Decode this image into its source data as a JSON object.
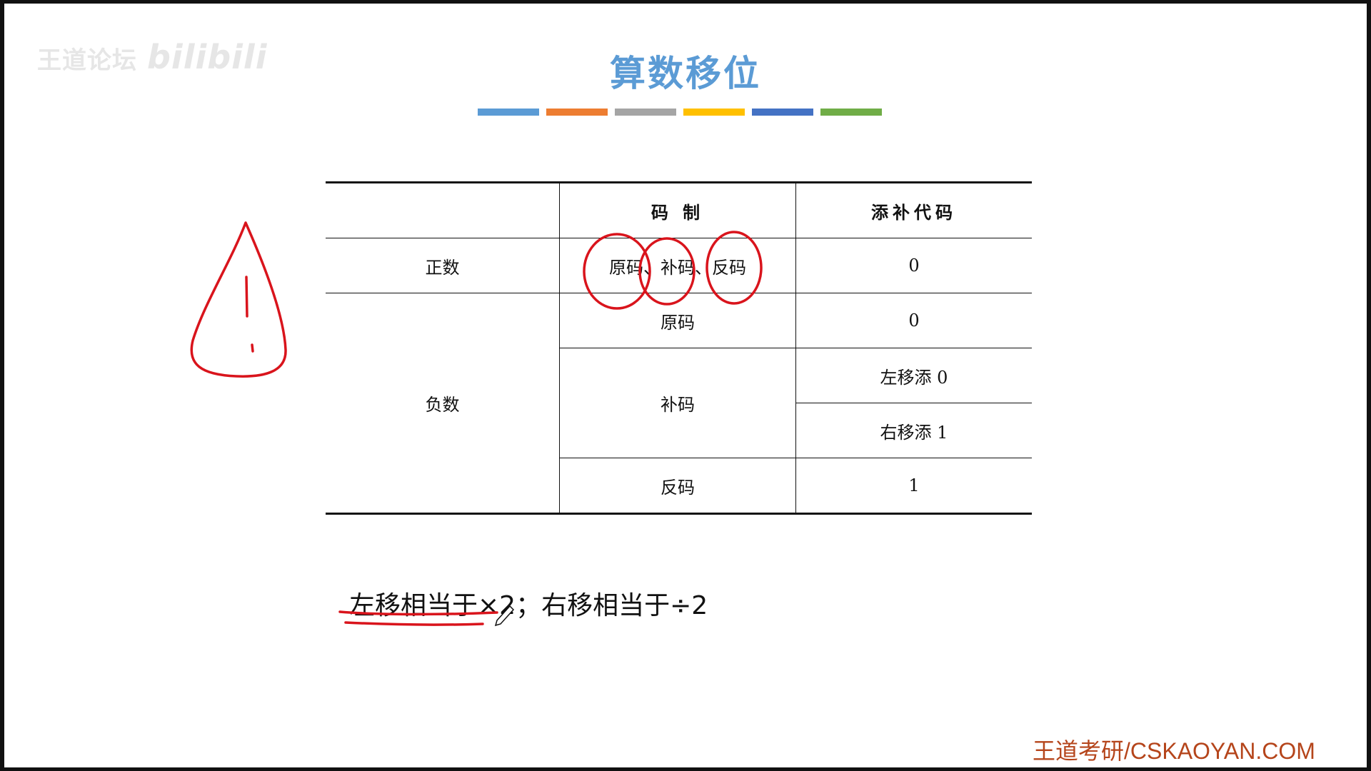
{
  "watermark": {
    "brand": "王道论坛",
    "site": "bilibili"
  },
  "slide_title": "算数移位",
  "accent_bars": [
    "#5b9bd5",
    "#ed7d31",
    "#a5a5a5",
    "#ffc000",
    "#4472c4",
    "#70ad47"
  ],
  "table": {
    "headers": [
      "",
      "码 制",
      "添补代码"
    ],
    "rows": {
      "positive": {
        "sign": "正数",
        "code": "原码、补码、反码",
        "fill": "0"
      },
      "neg_orig": {
        "sign": "负数",
        "code": "原码",
        "fill": "0"
      },
      "neg_comp": {
        "code": "补码",
        "fill_left": "左移添 0",
        "fill_right": "右移添 1"
      },
      "neg_ones": {
        "code": "反码",
        "fill": "1"
      }
    }
  },
  "note": "左移相当于×2；右移相当于÷2",
  "footer": "王道考研/CSKAOYAN.COM",
  "annotation_color": "#d9141c"
}
